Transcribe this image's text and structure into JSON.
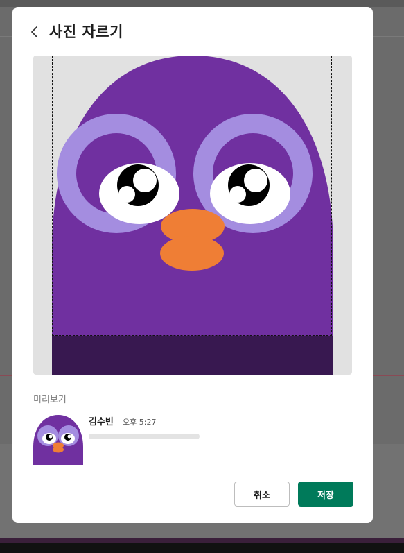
{
  "dialog": {
    "title": "사진 자르기",
    "back_icon": "chevron-left-icon"
  },
  "crop": {
    "image": "purple-owl-avatar"
  },
  "preview": {
    "label": "미리보기",
    "name": "김수빈",
    "time": "오후 5:27"
  },
  "actions": {
    "cancel_label": "취소",
    "save_label": "저장"
  },
  "colors": {
    "primary": "#007a5a",
    "owl_body": "#7030a0",
    "owl_eye_ring": "#a48de0",
    "owl_beak": "#ef7e35"
  }
}
